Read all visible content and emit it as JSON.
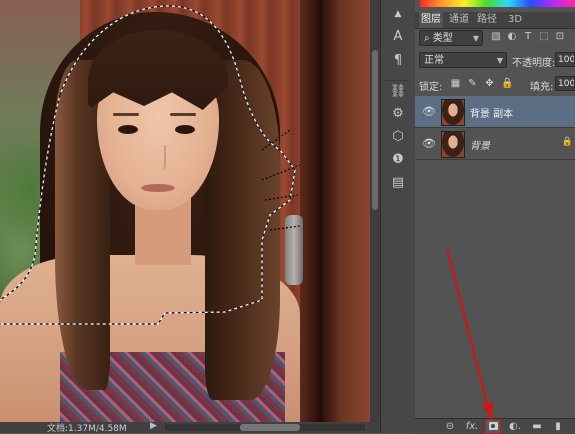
{
  "status_bar": {
    "doc_info": "文档:1.37M/4.58M",
    "nav_arrow": "▶"
  },
  "tools": [
    "type-tool-icon",
    "paragraph-icon",
    "adjust-icon",
    "properties-icon",
    "3d-icon",
    "info-icon",
    "notes-icon"
  ],
  "tool_glyphs": {
    "type": "A",
    "paragraph": "¶",
    "adjust": "⛓",
    "properties": "⚙",
    "cube": "⬡",
    "info": "❶",
    "notes": "▤"
  },
  "panel": {
    "tabs": [
      "图层",
      "通道",
      "路径",
      "3D"
    ],
    "filter_kind": "类型",
    "filter_icons": [
      "▧",
      "◐",
      "T",
      "⬚",
      "⊡"
    ],
    "blend_mode": "正常",
    "opacity_label": "不透明度:",
    "opacity_value": "100",
    "lock_label": "锁定:",
    "lock_icons": [
      "▦",
      "✎",
      "✥",
      "🔒"
    ],
    "fill_label": "填充:",
    "fill_value": "100",
    "layers": [
      {
        "name": "背景 副本",
        "visible": true,
        "selected": true
      },
      {
        "name": "背景",
        "visible": true,
        "selected": false,
        "locked": true
      }
    ],
    "bottom_icons": [
      "link-icon",
      "fx-icon",
      "add-mask-icon",
      "adjustment-layer-icon",
      "group-folder-icon",
      "new-layer-icon"
    ],
    "bottom_glyphs": {
      "link": "⊝",
      "fx": "fx.",
      "adjust": "◐.",
      "folder": "▬",
      "new": "▮"
    }
  },
  "colors": {
    "panel_bg": "#535353",
    "selected_layer": "#5c6e84",
    "annotation_arrow": "#d01616"
  }
}
